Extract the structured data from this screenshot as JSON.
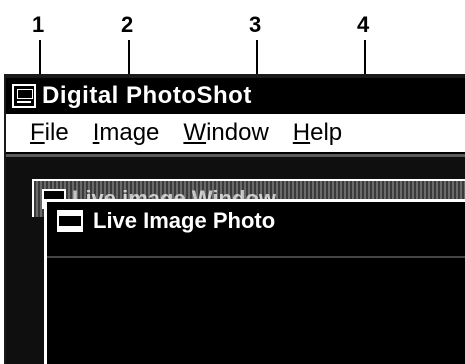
{
  "callouts": [
    "1",
    "2",
    "3",
    "4"
  ],
  "window": {
    "title": "Digital PhotoShot"
  },
  "menu": [
    {
      "mnemonic": "F",
      "rest": "ile"
    },
    {
      "mnemonic": "I",
      "rest": "mage"
    },
    {
      "mnemonic": "W",
      "rest": "indow"
    },
    {
      "mnemonic": "H",
      "rest": "elp"
    }
  ],
  "child_windows": [
    {
      "title": "Live image Window"
    },
    {
      "title": "Live Image Photo"
    }
  ],
  "colors": {
    "title_bar": "#000000",
    "menu_bar": "#ffffff",
    "mdi_background": "#0f0f0f"
  },
  "icons": {
    "app": "app-window-icon",
    "child": "window-icon"
  }
}
